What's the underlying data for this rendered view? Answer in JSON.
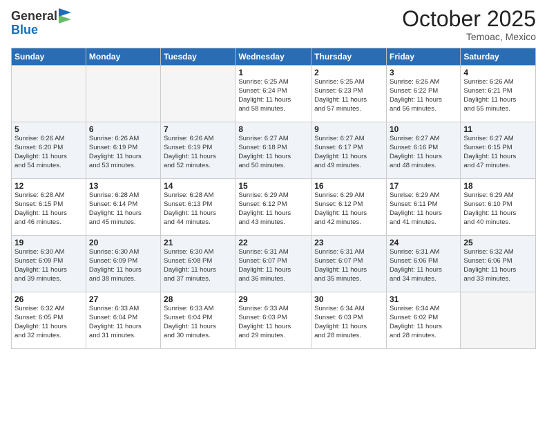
{
  "header": {
    "logo_general": "General",
    "logo_blue": "Blue",
    "month": "October 2025",
    "location": "Temoac, Mexico"
  },
  "weekdays": [
    "Sunday",
    "Monday",
    "Tuesday",
    "Wednesday",
    "Thursday",
    "Friday",
    "Saturday"
  ],
  "weeks": [
    [
      {
        "day": "",
        "info": ""
      },
      {
        "day": "",
        "info": ""
      },
      {
        "day": "",
        "info": ""
      },
      {
        "day": "1",
        "info": "Sunrise: 6:25 AM\nSunset: 6:24 PM\nDaylight: 11 hours\nand 58 minutes."
      },
      {
        "day": "2",
        "info": "Sunrise: 6:25 AM\nSunset: 6:23 PM\nDaylight: 11 hours\nand 57 minutes."
      },
      {
        "day": "3",
        "info": "Sunrise: 6:26 AM\nSunset: 6:22 PM\nDaylight: 11 hours\nand 56 minutes."
      },
      {
        "day": "4",
        "info": "Sunrise: 6:26 AM\nSunset: 6:21 PM\nDaylight: 11 hours\nand 55 minutes."
      }
    ],
    [
      {
        "day": "5",
        "info": "Sunrise: 6:26 AM\nSunset: 6:20 PM\nDaylight: 11 hours\nand 54 minutes."
      },
      {
        "day": "6",
        "info": "Sunrise: 6:26 AM\nSunset: 6:19 PM\nDaylight: 11 hours\nand 53 minutes."
      },
      {
        "day": "7",
        "info": "Sunrise: 6:26 AM\nSunset: 6:19 PM\nDaylight: 11 hours\nand 52 minutes."
      },
      {
        "day": "8",
        "info": "Sunrise: 6:27 AM\nSunset: 6:18 PM\nDaylight: 11 hours\nand 50 minutes."
      },
      {
        "day": "9",
        "info": "Sunrise: 6:27 AM\nSunset: 6:17 PM\nDaylight: 11 hours\nand 49 minutes."
      },
      {
        "day": "10",
        "info": "Sunrise: 6:27 AM\nSunset: 6:16 PM\nDaylight: 11 hours\nand 48 minutes."
      },
      {
        "day": "11",
        "info": "Sunrise: 6:27 AM\nSunset: 6:15 PM\nDaylight: 11 hours\nand 47 minutes."
      }
    ],
    [
      {
        "day": "12",
        "info": "Sunrise: 6:28 AM\nSunset: 6:15 PM\nDaylight: 11 hours\nand 46 minutes."
      },
      {
        "day": "13",
        "info": "Sunrise: 6:28 AM\nSunset: 6:14 PM\nDaylight: 11 hours\nand 45 minutes."
      },
      {
        "day": "14",
        "info": "Sunrise: 6:28 AM\nSunset: 6:13 PM\nDaylight: 11 hours\nand 44 minutes."
      },
      {
        "day": "15",
        "info": "Sunrise: 6:29 AM\nSunset: 6:12 PM\nDaylight: 11 hours\nand 43 minutes."
      },
      {
        "day": "16",
        "info": "Sunrise: 6:29 AM\nSunset: 6:12 PM\nDaylight: 11 hours\nand 42 minutes."
      },
      {
        "day": "17",
        "info": "Sunrise: 6:29 AM\nSunset: 6:11 PM\nDaylight: 11 hours\nand 41 minutes."
      },
      {
        "day": "18",
        "info": "Sunrise: 6:29 AM\nSunset: 6:10 PM\nDaylight: 11 hours\nand 40 minutes."
      }
    ],
    [
      {
        "day": "19",
        "info": "Sunrise: 6:30 AM\nSunset: 6:09 PM\nDaylight: 11 hours\nand 39 minutes."
      },
      {
        "day": "20",
        "info": "Sunrise: 6:30 AM\nSunset: 6:09 PM\nDaylight: 11 hours\nand 38 minutes."
      },
      {
        "day": "21",
        "info": "Sunrise: 6:30 AM\nSunset: 6:08 PM\nDaylight: 11 hours\nand 37 minutes."
      },
      {
        "day": "22",
        "info": "Sunrise: 6:31 AM\nSunset: 6:07 PM\nDaylight: 11 hours\nand 36 minutes."
      },
      {
        "day": "23",
        "info": "Sunrise: 6:31 AM\nSunset: 6:07 PM\nDaylight: 11 hours\nand 35 minutes."
      },
      {
        "day": "24",
        "info": "Sunrise: 6:31 AM\nSunset: 6:06 PM\nDaylight: 11 hours\nand 34 minutes."
      },
      {
        "day": "25",
        "info": "Sunrise: 6:32 AM\nSunset: 6:06 PM\nDaylight: 11 hours\nand 33 minutes."
      }
    ],
    [
      {
        "day": "26",
        "info": "Sunrise: 6:32 AM\nSunset: 6:05 PM\nDaylight: 11 hours\nand 32 minutes."
      },
      {
        "day": "27",
        "info": "Sunrise: 6:33 AM\nSunset: 6:04 PM\nDaylight: 11 hours\nand 31 minutes."
      },
      {
        "day": "28",
        "info": "Sunrise: 6:33 AM\nSunset: 6:04 PM\nDaylight: 11 hours\nand 30 minutes."
      },
      {
        "day": "29",
        "info": "Sunrise: 6:33 AM\nSunset: 6:03 PM\nDaylight: 11 hours\nand 29 minutes."
      },
      {
        "day": "30",
        "info": "Sunrise: 6:34 AM\nSunset: 6:03 PM\nDaylight: 11 hours\nand 28 minutes."
      },
      {
        "day": "31",
        "info": "Sunrise: 6:34 AM\nSunset: 6:02 PM\nDaylight: 11 hours\nand 28 minutes."
      },
      {
        "day": "",
        "info": ""
      }
    ]
  ]
}
